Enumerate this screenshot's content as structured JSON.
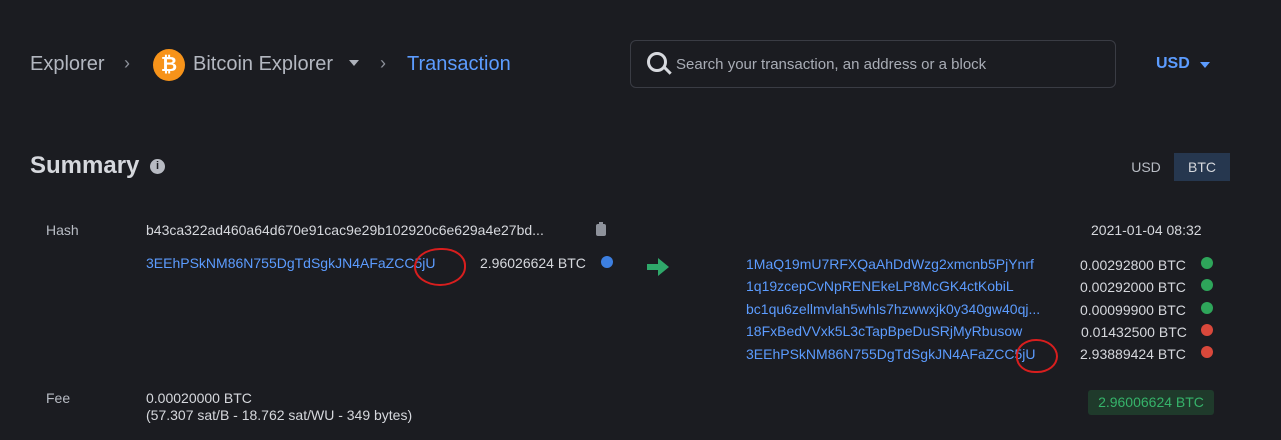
{
  "breadcrumb": {
    "explorer": "Explorer",
    "sep": "›",
    "coin_logo": "₿",
    "bitcoin_explorer": "Bitcoin Explorer",
    "current": "Transaction"
  },
  "search": {
    "placeholder": "Search your transaction, an address or a block"
  },
  "currency": {
    "selected": "USD"
  },
  "summary": {
    "title": "Summary",
    "info": "i",
    "unit_usd": "USD",
    "unit_btc": "BTC",
    "hash_label": "Hash",
    "hash": "b43ca322ad460a64d670e91cac9e29b102920c6e629a4e27bd...",
    "date": "2021-01-04 08:32",
    "input": {
      "address": "3EEhPSkNM86N755DgTdSgkJN4AFaZCC5jU",
      "amount": "2.96026624 BTC"
    },
    "outputs": [
      {
        "address": "1MaQ19mU7RFXQaAhDdWzg2xmcnb5PjYnrf",
        "amount": "0.00292800 BTC",
        "status": "green"
      },
      {
        "address": "1q19zcepCvNpRENEkeLP8McGK4ctKobiL",
        "amount": "0.00292000 BTC",
        "status": "green"
      },
      {
        "address": "bc1qu6zellmvlah5whls7hzwwxjk0y340gw40qj...",
        "amount": "0.00099900 BTC",
        "status": "green"
      },
      {
        "address": "18FxBedVVxk5L3cTapBpeDuSRjMyRbusow",
        "amount": "0.01432500 BTC",
        "status": "red"
      },
      {
        "address": "3EEhPSkNM86N755DgTdSgkJN4AFaZCC5jU",
        "amount": "2.93889424 BTC",
        "status": "red"
      }
    ],
    "fee_label": "Fee",
    "fee": "0.00020000 BTC",
    "fee_detail": "(57.307 sat/B - 18.762 sat/WU - 349 bytes)",
    "total": "2.96006624 BTC"
  },
  "colors": {
    "accent": "#5c9cff",
    "bitcoin": "#f7931a",
    "positive": "#36b36a",
    "annotation": "#d81e1e"
  },
  "icons": [
    "search-icon",
    "bitcoin-logo-icon",
    "chevron-down-icon",
    "info-icon",
    "clipboard-icon",
    "arrow-right-icon",
    "globe-icon"
  ]
}
